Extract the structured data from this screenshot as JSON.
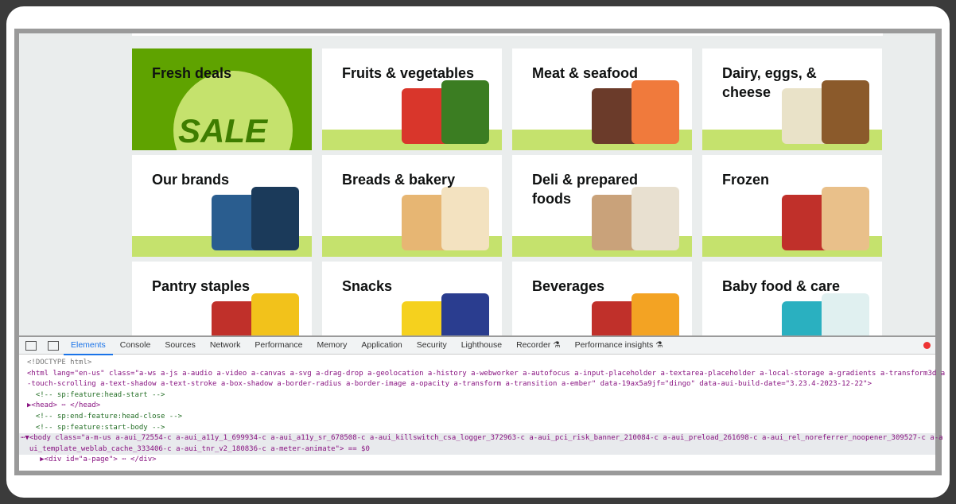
{
  "categories": [
    {
      "label": "Fresh deals",
      "badge": "SALE"
    },
    {
      "label": "Fruits & vegetables"
    },
    {
      "label": "Meat & seafood"
    },
    {
      "label": "Dairy, eggs, & cheese"
    },
    {
      "label": "Our brands"
    },
    {
      "label": "Breads & bakery"
    },
    {
      "label": "Deli & prepared foods"
    },
    {
      "label": "Frozen"
    },
    {
      "label": "Pantry staples"
    },
    {
      "label": "Snacks"
    },
    {
      "label": "Beverages"
    },
    {
      "label": "Baby food & care"
    }
  ],
  "devtools": {
    "tabs": [
      "Elements",
      "Console",
      "Sources",
      "Network",
      "Performance",
      "Memory",
      "Application",
      "Security",
      "Lighthouse",
      "Recorder ⚗",
      "Performance insights ⚗"
    ],
    "active_tab": "Elements",
    "lines": [
      "<!DOCTYPE html>",
      "<html lang=\"en-us\" class=\"a-ws a-js a-audio a-video a-canvas a-svg a-drag-drop a-geolocation a-history a-webworker a-autofocus a-input-placeholder a-textarea-placeholder a-local-storage a-gradients a-transform3d a",
      "-touch-scrolling a-text-shadow a-text-stroke a-box-shadow a-border-radius a-border-image a-opacity a-transform a-transition a-ember\" data-19ax5a9jf=\"dingo\" data-aui-build-date=\"3.23.4-2023-12-22\">",
      "  <!-- sp:feature:head-start -->",
      "▶<head> ⋯ </head>",
      "  <!-- sp:end-feature:head-close -->",
      "  <!-- sp:feature:start-body -->",
      "⋯▼<body class=\"a-m-us a-aui_72554-c a-aui_a11y_1_699934-c a-aui_a11y_sr_678508-c a-aui_killswitch_csa_logger_372963-c a-aui_pci_risk_banner_210084-c a-aui_preload_261698-c a-aui_rel_noreferrer_noopener_309527-c a-a",
      "  ui_template_weblab_cache_333406-c a-aui_tnr_v2_180836-c a-meter-animate\"> == $0",
      "   ▶<div id=\"a-page\"> ⋯ </div>"
    ]
  }
}
